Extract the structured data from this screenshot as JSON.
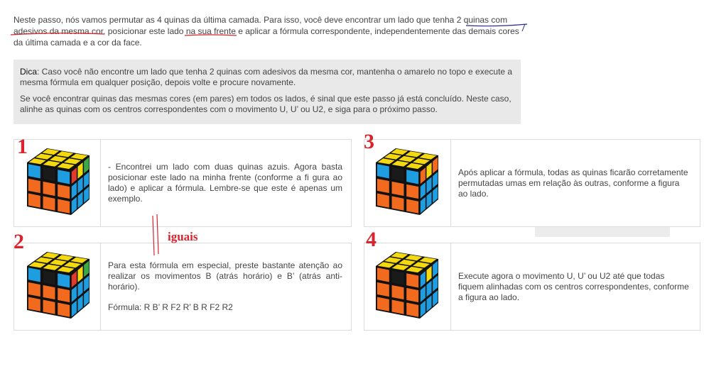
{
  "intro": {
    "part1": "Neste passo, nós vamos permutar as 4 quinas da última camada. Para isso, você deve encontrar um lado que tenha ",
    "highlight1": "2 quinas com adesivos da mesma cor",
    "part2": ", posicionar este lado ",
    "highlight2": "na sua frente",
    "part3": " e aplicar a fórmula correspondente, independentemente das demais cores da última camada e a cor da face."
  },
  "tip": {
    "label": "Dica",
    "text1": ": Caso você não encontre um lado que tenha 2 quinas com adesivos da mesma cor, mantenha o amarelo no topo e execute a mesma fórmula em qualquer posição, depois volte e procure novamente.",
    "text2": "Se você encontrar quinas das mesmas cores (em pares) em todos os lados, é sinal que este passo já está concluído. Neste caso, alinhe as quinas com os centros correspondentes com o movimento U, U’ ou U2, e siga para o próximo passo."
  },
  "steps": [
    {
      "number": "1",
      "text": "- Encontrei um lado com duas quinas azuis. Agora basta posicionar este lado na minha frente (conforme a fi gura ao lado) e aplicar a fórmula. Lembre-se que este é apenas um exemplo."
    },
    {
      "number": "2",
      "text": "Para esta fórmula em especial, preste bastante atenção ao realizar os movimentos B (atrás horário) e B’ (atrás anti-horário).",
      "formula": "Fórmula: R B’ R F2 R’ B R F2 R2"
    },
    {
      "number": "3",
      "text": "Após aplicar a fórmula, todas as quinas ficarão corretamente permutadas umas em relação às outras, conforme a figura ao lado."
    },
    {
      "number": "4",
      "text": "Execute agora o movimento U, U’ ou U2 até que todas fiquem alinhadas com os centros correspondentes, conforme a figura ao lado."
    }
  ],
  "annotation": {
    "label": "iguais",
    "color": "#d9232d"
  },
  "colors": {
    "red_accent": "#d9232d",
    "tip_bg": "#e9e9e9",
    "border": "#dcdcdc"
  },
  "cubes": {
    "step1": {
      "top": [
        "#f5d90f",
        "#f5d90f",
        "#f5d90f",
        "#f5d90f",
        "#f5d90f",
        "#f5d90f",
        "#f5d90f",
        "#f5d90f",
        "#f5d90f"
      ],
      "front": [
        "#1e9de0",
        "#1a1a1a",
        "#1e9de0",
        "#f26a1e",
        "#f26a1e",
        "#f26a1e",
        "#f26a1e",
        "#f26a1e",
        "#f26a1e"
      ],
      "right": [
        "#e23a2d",
        "#f5d90f",
        "#3aa845",
        "#1e9de0",
        "#1e9de0",
        "#1e9de0",
        "#1e9de0",
        "#1e9de0",
        "#1e9de0"
      ]
    },
    "step2": {
      "top": [
        "#f5d90f",
        "#f5d90f",
        "#f5d90f",
        "#f5d90f",
        "#f5d90f",
        "#f5d90f",
        "#f5d90f",
        "#f5d90f",
        "#f5d90f"
      ],
      "front": [
        "#1e9de0",
        "#1a1a1a",
        "#1e9de0",
        "#f26a1e",
        "#f26a1e",
        "#f26a1e",
        "#f26a1e",
        "#f26a1e",
        "#f26a1e"
      ],
      "right": [
        "#e23a2d",
        "#f5d90f",
        "#3aa845",
        "#1e9de0",
        "#1e9de0",
        "#1e9de0",
        "#1e9de0",
        "#1e9de0",
        "#1e9de0"
      ]
    },
    "step3": {
      "top": [
        "#f5d90f",
        "#f5d90f",
        "#f5d90f",
        "#f5d90f",
        "#f5d90f",
        "#f5d90f",
        "#f5d90f",
        "#f5d90f",
        "#f5d90f"
      ],
      "front": [
        "#1e9de0",
        "#1a1a1a",
        "#1e9de0",
        "#f26a1e",
        "#f26a1e",
        "#f26a1e",
        "#f26a1e",
        "#f26a1e",
        "#f26a1e"
      ],
      "right": [
        "#f26a1e",
        "#f5d90f",
        "#f26a1e",
        "#1e9de0",
        "#1e9de0",
        "#1e9de0",
        "#1e9de0",
        "#1e9de0",
        "#1e9de0"
      ]
    },
    "step4": {
      "top": [
        "#f5d90f",
        "#f5d90f",
        "#f5d90f",
        "#f5d90f",
        "#f5d90f",
        "#f5d90f",
        "#f5d90f",
        "#f5d90f",
        "#f5d90f"
      ],
      "front": [
        "#f26a1e",
        "#1a1a1a",
        "#f26a1e",
        "#f26a1e",
        "#f26a1e",
        "#f26a1e",
        "#f26a1e",
        "#f26a1e",
        "#f26a1e"
      ],
      "right": [
        "#1e9de0",
        "#f5d90f",
        "#1e9de0",
        "#1e9de0",
        "#1e9de0",
        "#1e9de0",
        "#1e9de0",
        "#1e9de0",
        "#1e9de0"
      ]
    }
  }
}
